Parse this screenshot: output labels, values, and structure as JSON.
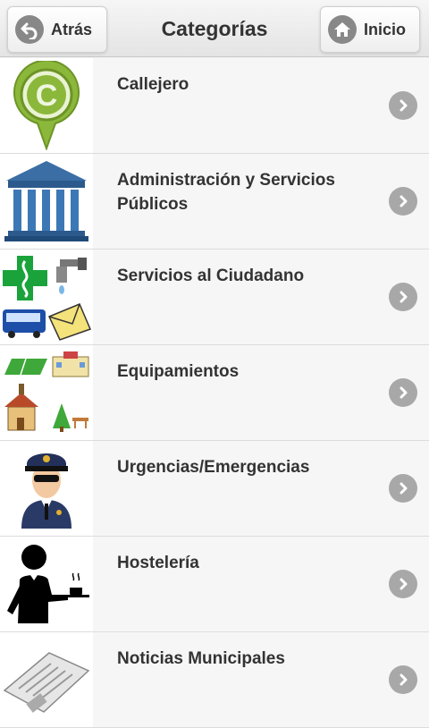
{
  "header": {
    "title": "Categorías",
    "back_label": "Atrás",
    "home_label": "Inicio"
  },
  "categories": [
    {
      "label": "Callejero",
      "icon": "map-pin-c-icon"
    },
    {
      "label": "Administración y Servicios Públicos",
      "icon": "government-building-icon"
    },
    {
      "label": "Servicios al Ciudadano",
      "icon": "citizen-services-icon"
    },
    {
      "label": "Equipamientos",
      "icon": "facilities-icon"
    },
    {
      "label": "Urgencias/Emergencias",
      "icon": "police-officer-icon"
    },
    {
      "label": "Hostelería",
      "icon": "waiter-icon"
    },
    {
      "label": "Noticias Municipales",
      "icon": "newspaper-icon"
    }
  ]
}
